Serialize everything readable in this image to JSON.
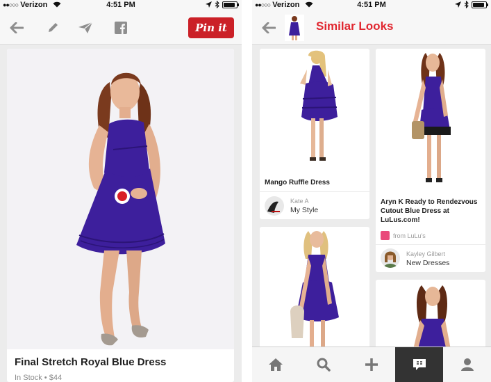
{
  "status_bar": {
    "carrier": "Verizon",
    "time": "4:51 PM"
  },
  "left_screen": {
    "pin_button_label": "Pin it",
    "pin": {
      "title": "Final Stretch Royal Blue Dress",
      "availability": "In Stock • $44"
    }
  },
  "right_screen": {
    "title": "Similar Looks",
    "cards": [
      {
        "title": "Mango Ruffle Dress",
        "pinner": "Kate A",
        "board": "My Style"
      },
      {
        "title": "Aryn K Ready to Rendezvous Cutout Blue Dress at LuLus.com!",
        "source": "from LuLu's",
        "pinner": "Kayley Gilbert",
        "board": "New Dresses"
      }
    ],
    "tabs": [
      "home-icon",
      "search-icon",
      "add-icon",
      "news-icon",
      "profile-icon"
    ]
  },
  "colors": {
    "pinterest_red": "#cb2027",
    "dress_blue": "#3d1f9c",
    "title_red": "#e1262f"
  }
}
